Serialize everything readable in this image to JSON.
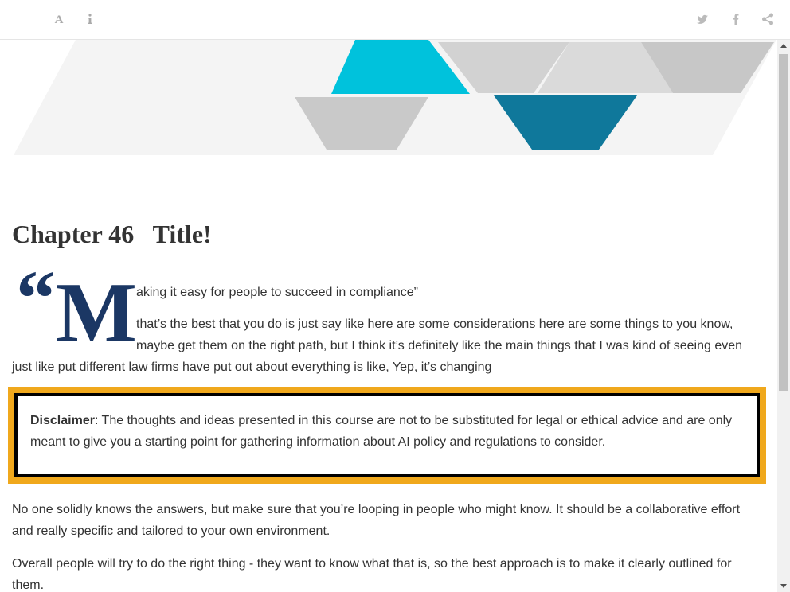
{
  "toolbar": {
    "font_button": "A",
    "icons": [
      "font-size-icon",
      "info-icon",
      "twitter-icon",
      "facebook-icon",
      "share-icon"
    ]
  },
  "colors": {
    "quote_navy": "#1b3764",
    "banner_cyan": "#00c2dc",
    "banner_teal": "#0f789b",
    "banner_gray": "#c9c9c9",
    "disclaimer_border_outer": "#f0a81c",
    "disclaimer_border_inner": "#000000"
  },
  "chapter": {
    "title": "Chapter 46   Title!"
  },
  "quote": {
    "mark": "“",
    "drop_cap": "M",
    "rest": "aking it easy for people to succeed in compliance”"
  },
  "paragraphs": {
    "p1": "that’s the best that you do is just say like here are some considerations here are some things to you know, maybe get them on the right path, but I think it’s definitely like the main things that I was kind of seeing even just like put different law firms have put out about everything is like, Yep, it’s changing",
    "p2": "No one solidly knows the answers, but make sure that you’re looping in people who might know. It should be a collaborative effort and really specific and tailored to your own environment.",
    "p3": "Overall people will try to do the right thing - they want to know what that is, so the best approach is to make it clearly outlined for them."
  },
  "disclaimer": {
    "label": "Disclaimer",
    "text": ": The thoughts and ideas presented in this course are not to be substituted for legal or ethical advice and are only meant to give you a starting point for gathering information about AI policy and regulations to consider."
  }
}
